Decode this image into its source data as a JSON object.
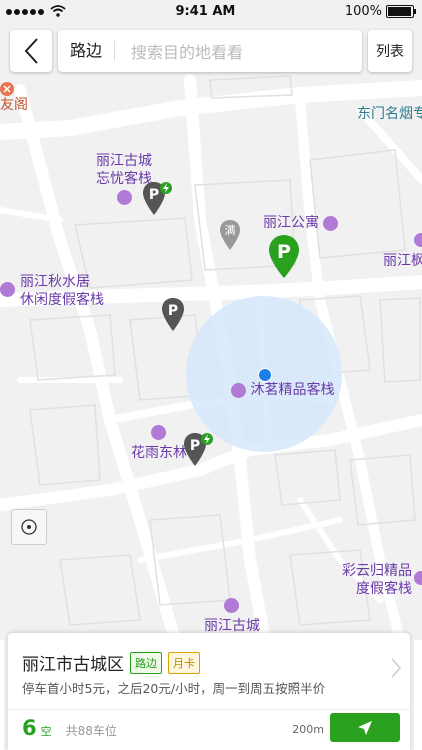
{
  "status_bar": {
    "time": "9:41 AM",
    "battery": "100%"
  },
  "search_bar": {
    "mode": "路边",
    "placeholder": "搜索目的地看看",
    "list_label": "列表"
  },
  "map": {
    "pois": {
      "youge": "友阁",
      "dongmen": "东门名烟专",
      "wangyou_1": "丽江古城",
      "wangyou_2": "忘忧客栈",
      "apartment": "丽江公寓",
      "lijiang_right": "丽江枫",
      "qiushui_1": "丽江秋水居",
      "qiushui_2": "休闲度假客栈",
      "muming": "沐茗精品客栈",
      "huayu": "花雨东林",
      "caiyun_1": "彩云归精品",
      "caiyun_2": "度假客栈",
      "gucheng": "丽江古城"
    },
    "full_marker_label": "满",
    "parking_letter": "P"
  },
  "parking_card": {
    "title": "丽江市古城区",
    "tag_street": "路边",
    "tag_monthly": "月卡",
    "description": "停车首小时5元，之后20元/小时，周一到周五按照半价",
    "free_spaces": "6",
    "free_unit": "空",
    "total": "共88车位",
    "distance": "200m"
  },
  "colors": {
    "accent_green": "#2aa01f",
    "poi_purple": "#6a3aa8",
    "marker_dark": "#555555"
  }
}
